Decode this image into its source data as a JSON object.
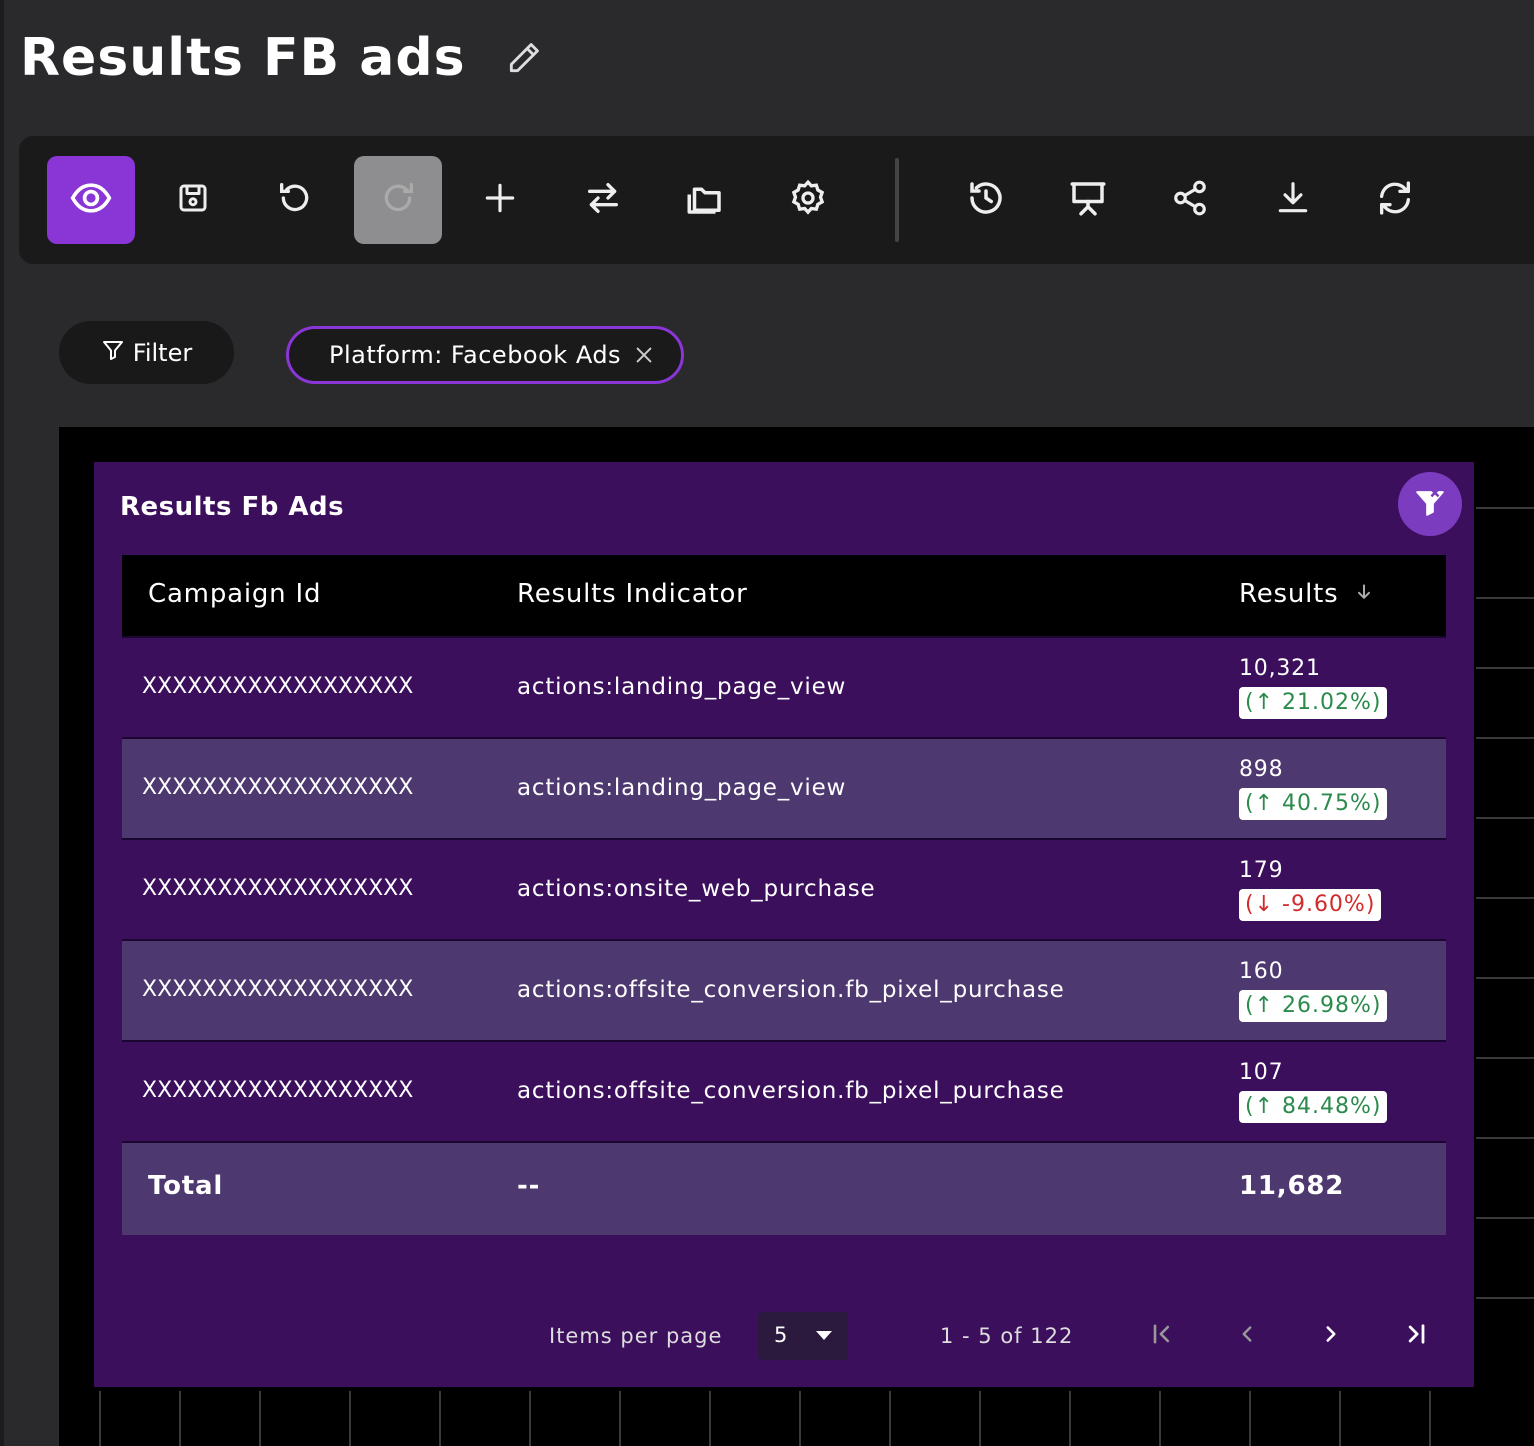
{
  "page": {
    "title": "Results FB ads"
  },
  "toolbar": {
    "buttons": [
      {
        "icon": "eye-icon"
      },
      {
        "icon": "save-icon"
      },
      {
        "icon": "undo-icon"
      },
      {
        "icon": "redo-icon"
      },
      {
        "icon": "plus-icon"
      },
      {
        "icon": "swap-icon"
      },
      {
        "icon": "folders-icon"
      },
      {
        "icon": "gear-icon"
      },
      {
        "icon": "history-icon"
      },
      {
        "icon": "presentation-icon"
      },
      {
        "icon": "share-icon"
      },
      {
        "icon": "download-icon"
      },
      {
        "icon": "refresh-icon"
      }
    ]
  },
  "filters": {
    "filter_label": "Filter",
    "chips": [
      {
        "label": "Platform: Facebook Ads"
      }
    ]
  },
  "widget": {
    "title": "Results Fb Ads",
    "table": {
      "columns": [
        "Campaign Id",
        "Results Indicator",
        "Results"
      ],
      "sort": {
        "column": "Results",
        "direction": "desc"
      },
      "rows": [
        {
          "campaign_id": "XXXXXXXXXXXXXXXXXX",
          "indicator": "actions:landing_page_view",
          "results": "10,321",
          "change": "(↑ 21.02%)",
          "trend": "up"
        },
        {
          "campaign_id": "XXXXXXXXXXXXXXXXXX",
          "indicator": "actions:landing_page_view",
          "results": "898",
          "change": "(↑ 40.75%)",
          "trend": "up"
        },
        {
          "campaign_id": "XXXXXXXXXXXXXXXXXX",
          "indicator": "actions:onsite_web_purchase",
          "results": "179",
          "change": "(↓ -9.60%)",
          "trend": "down"
        },
        {
          "campaign_id": "XXXXXXXXXXXXXXXXXX",
          "indicator": "actions:offsite_conversion.fb_pixel_purchase",
          "results": "160",
          "change": "(↑ 26.98%)",
          "trend": "up"
        },
        {
          "campaign_id": "XXXXXXXXXXXXXXXXXX",
          "indicator": "actions:offsite_conversion.fb_pixel_purchase",
          "results": "107",
          "change": "(↑ 84.48%)",
          "trend": "up"
        }
      ],
      "total": {
        "label": "Total",
        "indicator": "--",
        "results": "11,682"
      }
    },
    "pagination": {
      "items_per_page_label": "Items per page",
      "items_per_page": "5",
      "range": "1 - 5 of 122"
    }
  },
  "colors": {
    "accent": "#8a35d6",
    "widget_bg": "#3b0f5c",
    "row_alt": "#4e3870",
    "up": "#2b8a4c",
    "down": "#d12b2b"
  }
}
